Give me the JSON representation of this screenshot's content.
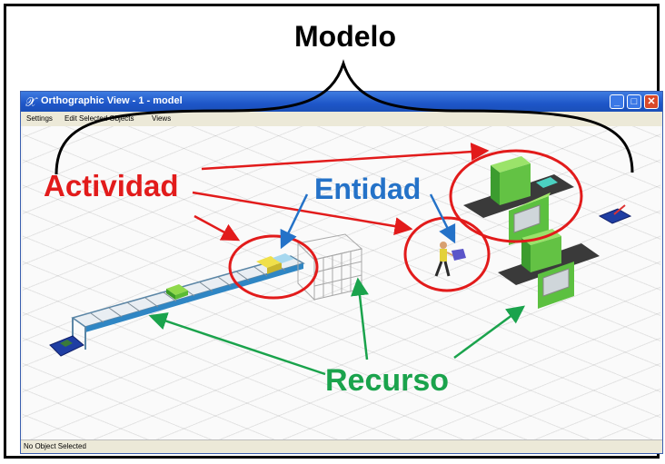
{
  "annotations": {
    "heading": "Modelo",
    "actividad": "Actividad",
    "entidad": "Entidad",
    "recurso": "Recurso",
    "colors": {
      "actividad": "#e21b1b",
      "entidad": "#2472c8",
      "recurso": "#1aa34c"
    }
  },
  "window": {
    "title": "Orthographic View - 1 - model",
    "icon": "x-logo-icon",
    "menu": [
      "Settings",
      "Edit Selected Objects",
      "Views"
    ],
    "status": "No Object Selected",
    "controls": {
      "minimize": "_",
      "maximize": "□",
      "close": "✕"
    }
  }
}
